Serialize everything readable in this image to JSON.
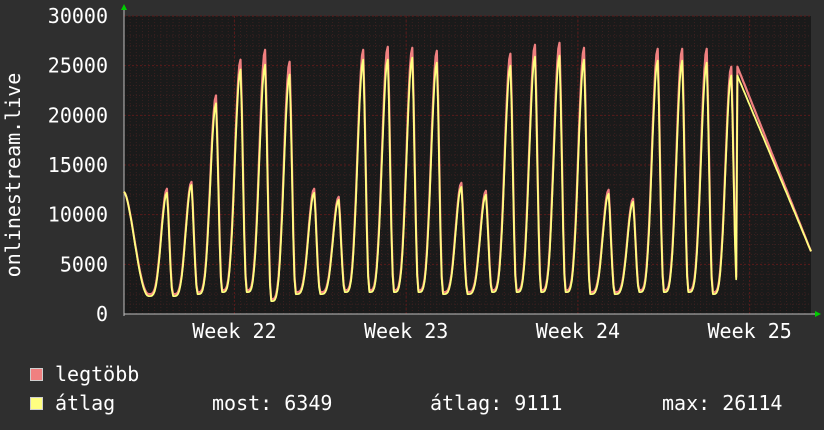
{
  "chart_data": {
    "type": "line",
    "ylabel": "onlinestream.live",
    "ylim": [
      0,
      30000
    ],
    "yticks": [
      0,
      5000,
      10000,
      15000,
      20000,
      25000,
      30000
    ],
    "xlim": [
      0,
      28
    ],
    "xticks": [
      {
        "label": "Week 22",
        "x": 4.5
      },
      {
        "label": "Week 23",
        "x": 11.5
      },
      {
        "label": "Week 24",
        "x": 18.5
      },
      {
        "label": "Week 25",
        "x": 25.5
      }
    ],
    "grid": true,
    "colors": {
      "background": "#2f2f2f",
      "plot_background": "#1a1a1a",
      "grid": "#5a1a1a",
      "peak_line": "#f08080",
      "avg_line": "#ffff80",
      "axis_arrow": "#00cc00"
    },
    "series": [
      {
        "name": "legtöbb",
        "color": "#f08080",
        "daily_peaks": [
          12600,
          13300,
          22000,
          25600,
          26600,
          25400,
          12600,
          11800,
          26600,
          26900,
          26800,
          26500,
          13200,
          12400,
          26200,
          27100,
          27300,
          26800,
          12500,
          11600,
          26700,
          26700,
          26700,
          24900
        ],
        "daily_lows": [
          2000,
          2000,
          2200,
          2400,
          2400,
          1500,
          2200,
          2200,
          2400,
          2400,
          2400,
          2400,
          2200,
          2200,
          2400,
          2400,
          2400,
          2400,
          2200,
          2200,
          2400,
          2400,
          2400,
          2200
        ]
      },
      {
        "name": "átlag",
        "color": "#ffff80",
        "daily_peaks": [
          12200,
          13000,
          21200,
          24600,
          25100,
          24100,
          12200,
          11500,
          25600,
          25600,
          25800,
          25300,
          12800,
          12000,
          25000,
          25900,
          26000,
          25600,
          12100,
          11300,
          25500,
          25500,
          25300,
          24000
        ],
        "daily_lows": [
          1800,
          1800,
          2000,
          2200,
          2200,
          1300,
          2000,
          2000,
          2200,
          2200,
          2200,
          2200,
          2000,
          2000,
          2200,
          2200,
          2200,
          2200,
          2000,
          2000,
          2200,
          2200,
          2200,
          2000
        ]
      }
    ],
    "start_value": 12300,
    "end_value": 6300
  },
  "legend": {
    "max_label": "legtöbb",
    "avg_label": "átlag",
    "current": "most: 6349",
    "average": "átlag: 9111",
    "maximum": "max: 26114"
  }
}
